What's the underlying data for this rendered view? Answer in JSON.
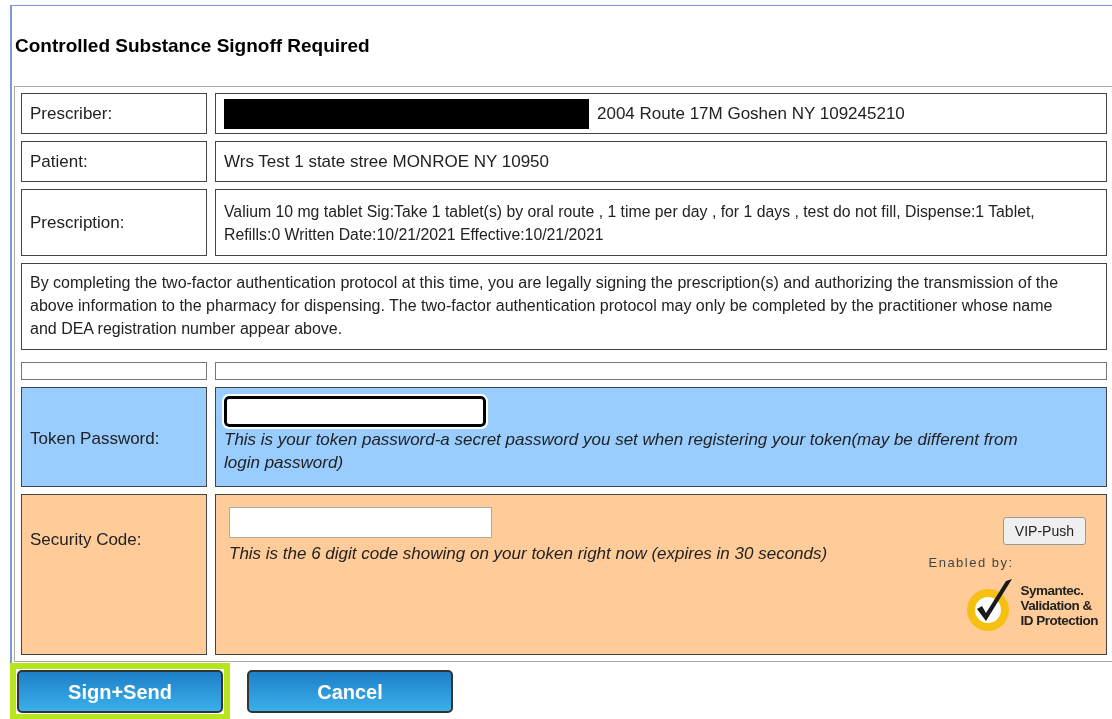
{
  "title": "Controlled Substance Signoff Required",
  "rows": [
    {
      "label": "Prescriber:",
      "value": "2004 Route 17M Goshen NY 109245210",
      "redacted": true
    },
    {
      "label": "Patient:",
      "value": "Wrs Test 1 state stree MONROE NY 10950",
      "redacted": false
    },
    {
      "label": "Prescription:",
      "value": "Valium 10 mg tablet Sig:Take 1 tablet(s) by oral route , 1 time per day , for 1 days , test do not fill, Dispense:1 Tablet, Refills:0 Written Date:10/21/2021 Effective:10/21/2021",
      "redacted": false
    }
  ],
  "statement": "By completing the two-factor authentication protocol at this time, you are legally signing the prescription(s) and authorizing the transmission of the above information to the pharmacy for dispensing. The two-factor authentication protocol may only be completed by the practitioner whose name and DEA registration number appear above.",
  "token_password": {
    "label": "Token Password:",
    "focused": true,
    "hint": "This is your token password-a secret password you set when registering your token(may be different from login password)"
  },
  "security_code": {
    "label": "Security Code:",
    "focused": false,
    "hint": "This is the 6 digit code showing on your token right now (expires in 30 seconds)",
    "push_button": "VIP-Push",
    "enabled_by": "Enabled by:",
    "logo_lines": [
      "Symantec.",
      "Validation &",
      "ID Protection"
    ]
  },
  "buttons": [
    {
      "label": "Sign+Send",
      "highlighted": true
    },
    {
      "label": "Cancel",
      "highlighted": false
    }
  ]
}
